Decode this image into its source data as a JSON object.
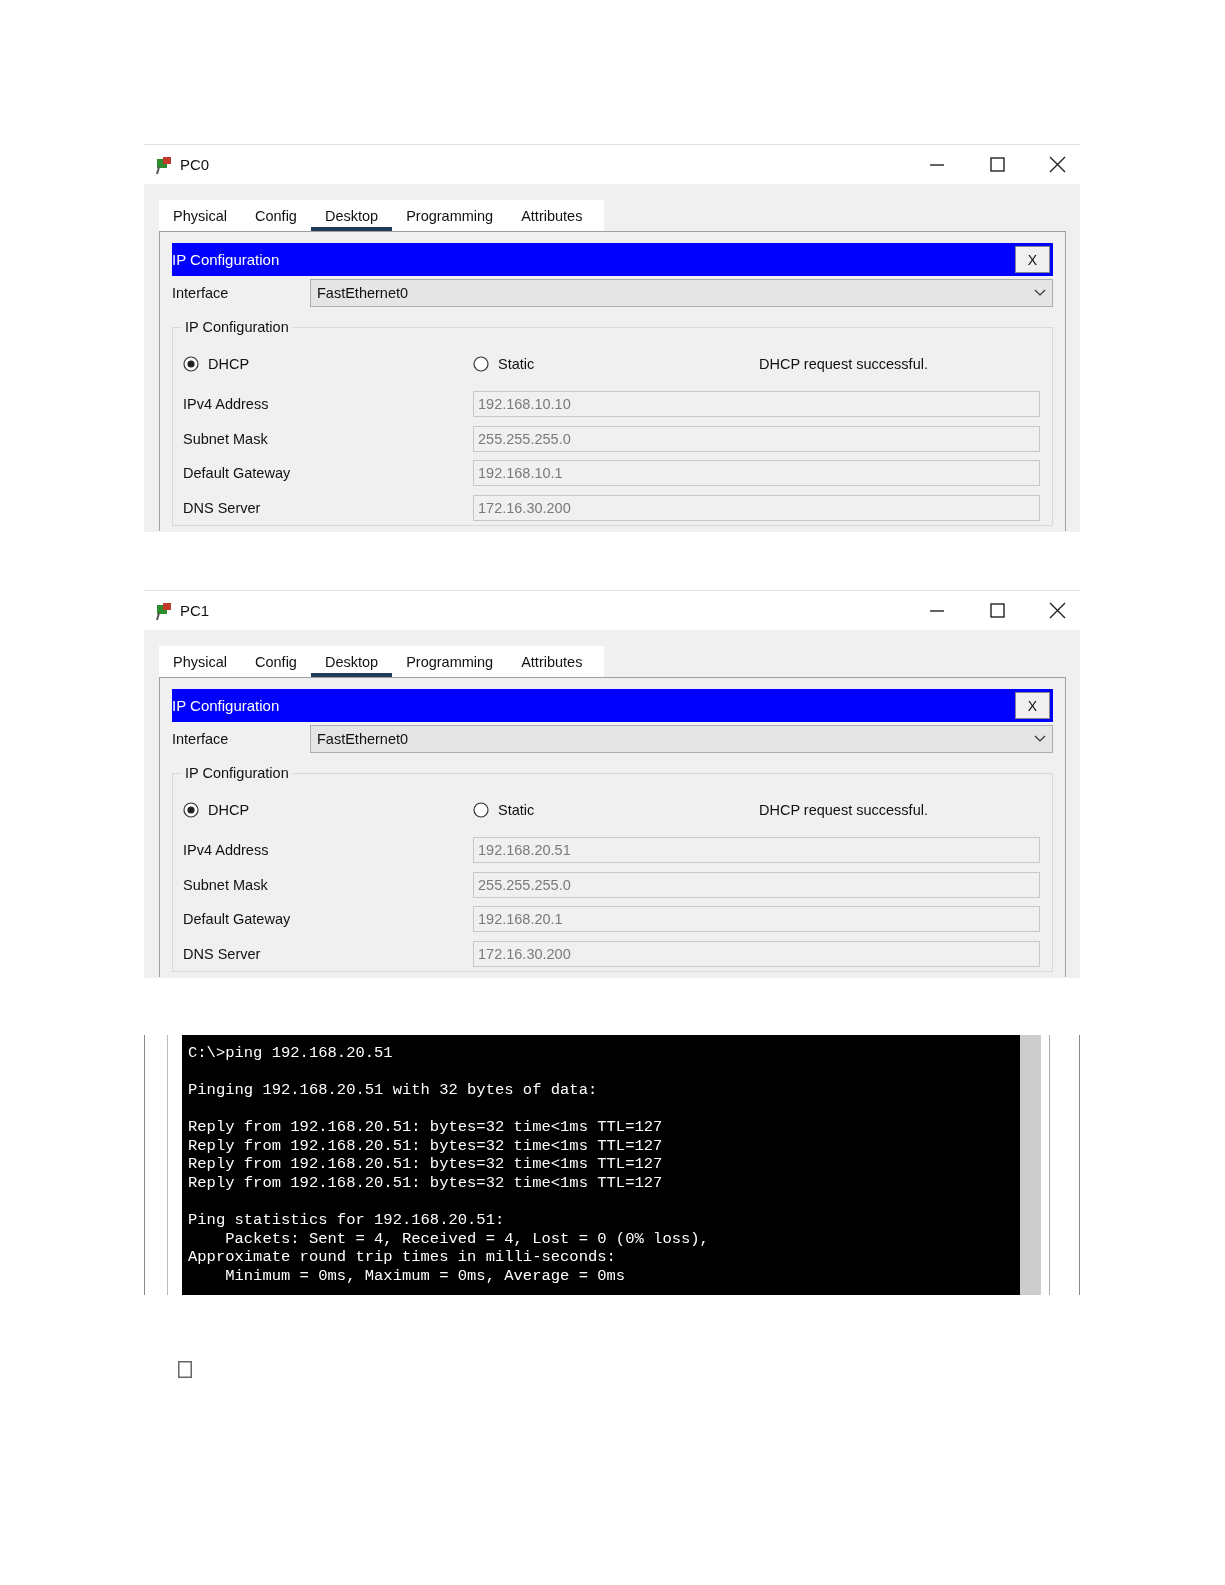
{
  "windows": [
    {
      "title": "PC0",
      "tabs": [
        {
          "label": "Physical",
          "selected": false
        },
        {
          "label": "Config",
          "selected": false
        },
        {
          "label": "Desktop",
          "selected": true
        },
        {
          "label": "Programming",
          "selected": false
        },
        {
          "label": "Attributes",
          "selected": false
        }
      ],
      "panel": {
        "title": "IP Configuration",
        "close": "X",
        "interface_label": "Interface",
        "interface_value": "FastEthernet0",
        "group_title": "IP Configuration",
        "modes": [
          {
            "label": "DHCP",
            "selected": true
          },
          {
            "label": "Static",
            "selected": false
          }
        ],
        "status": "DHCP request successful.",
        "fields": [
          {
            "label": "IPv4 Address",
            "value": "192.168.10.10"
          },
          {
            "label": "Subnet Mask",
            "value": "255.255.255.0"
          },
          {
            "label": "Default Gateway",
            "value": "192.168.10.1"
          },
          {
            "label": "DNS Server",
            "value": "172.16.30.200"
          }
        ]
      }
    },
    {
      "title": "PC1",
      "tabs": [
        {
          "label": "Physical",
          "selected": false
        },
        {
          "label": "Config",
          "selected": false
        },
        {
          "label": "Desktop",
          "selected": true
        },
        {
          "label": "Programming",
          "selected": false
        },
        {
          "label": "Attributes",
          "selected": false
        }
      ],
      "panel": {
        "title": "IP Configuration",
        "close": "X",
        "interface_label": "Interface",
        "interface_value": "FastEthernet0",
        "group_title": "IP Configuration",
        "modes": [
          {
            "label": "DHCP",
            "selected": true
          },
          {
            "label": "Static",
            "selected": false
          }
        ],
        "status": "DHCP request successful.",
        "fields": [
          {
            "label": "IPv4 Address",
            "value": "192.168.20.51"
          },
          {
            "label": "Subnet Mask",
            "value": "255.255.255.0"
          },
          {
            "label": "Default Gateway",
            "value": "192.168.20.1"
          },
          {
            "label": "DNS Server",
            "value": "172.16.30.200"
          }
        ]
      }
    }
  ],
  "terminal": {
    "blocks": [
      [
        "C:\\>ping 192.168.20.51"
      ],
      [
        "Pinging 192.168.20.51 with 32 bytes of data:"
      ],
      [
        "Reply from 192.168.20.51: bytes=32 time<1ms TTL=127",
        "Reply from 192.168.20.51: bytes=32 time<1ms TTL=127",
        "Reply from 192.168.20.51: bytes=32 time<1ms TTL=127",
        "Reply from 192.168.20.51: bytes=32 time<1ms TTL=127"
      ],
      [
        "Ping statistics for 192.168.20.51:",
        "    Packets: Sent = 4, Received = 4, Lost = 0 (0% loss),",
        "Approximate round trip times in milli-seconds:",
        "    Minimum = 0ms, Maximum = 0ms, Average = 0ms"
      ]
    ]
  },
  "checkbox": {
    "checked": false
  }
}
